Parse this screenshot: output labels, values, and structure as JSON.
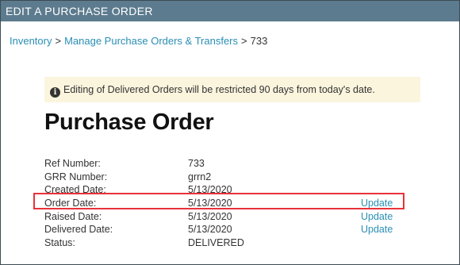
{
  "header": {
    "title": "EDIT A PURCHASE ORDER"
  },
  "breadcrumb": {
    "items": [
      "Inventory",
      "Manage Purchase Orders & Transfers"
    ],
    "separator": ">",
    "current": "733"
  },
  "notice": {
    "icon": "info-circle-icon",
    "text": "Editing of Delivered Orders will be restricted 90 days from today's date."
  },
  "page_title": "Purchase Order",
  "details": {
    "rows": [
      {
        "label": "Ref Number:",
        "value": "733",
        "action": ""
      },
      {
        "label": "GRR Number:",
        "value": "grrn2",
        "action": ""
      },
      {
        "label": "Created Date:",
        "value": "5/13/2020",
        "action": ""
      },
      {
        "label": "Order Date:",
        "value": "5/13/2020",
        "action": "Update"
      },
      {
        "label": "Raised Date:",
        "value": "5/13/2020",
        "action": "Update"
      },
      {
        "label": "Delivered Date:",
        "value": "5/13/2020",
        "action": "Update"
      },
      {
        "label": "Status:",
        "value": "DELIVERED",
        "action": ""
      }
    ]
  },
  "colors": {
    "titlebar": "#5c7b8e",
    "link": "#2a8fb5",
    "notice_bg": "#fbf5de",
    "highlight": "#e8323a"
  }
}
